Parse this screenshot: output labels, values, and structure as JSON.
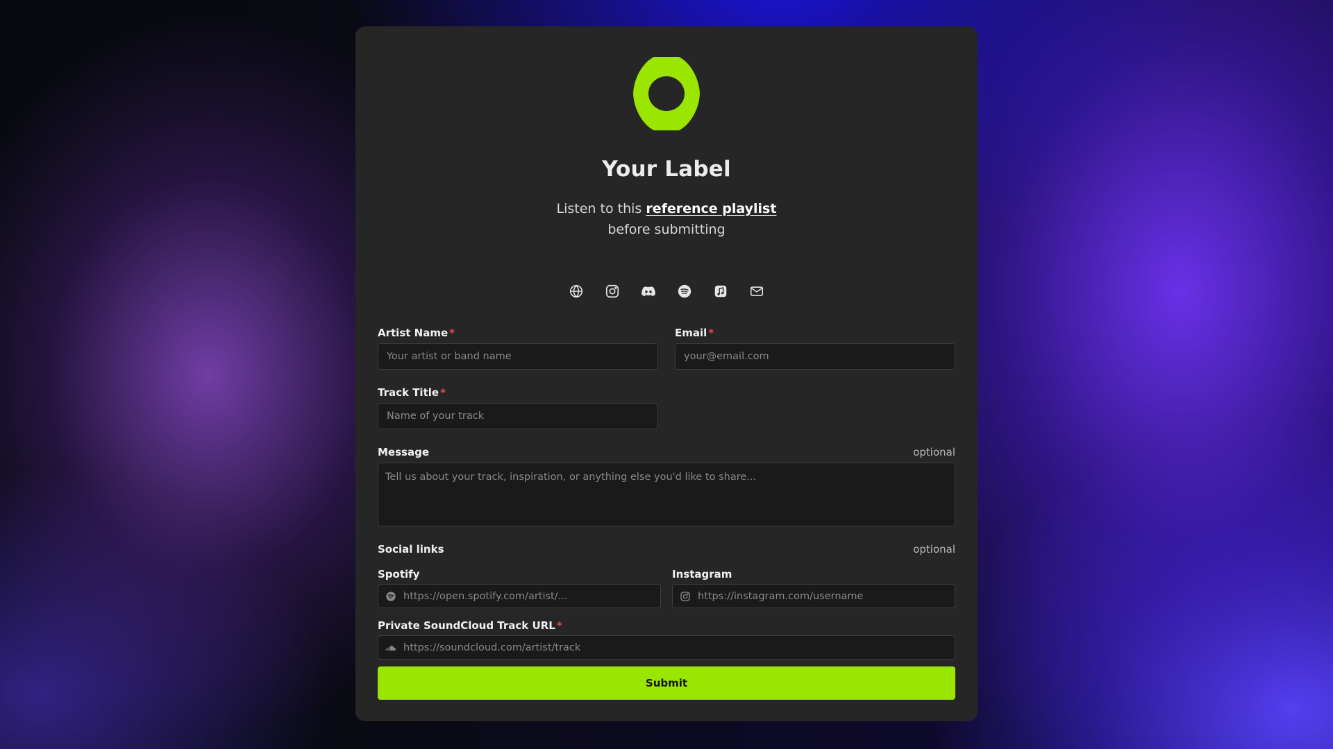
{
  "brand": {
    "name": "Your Label",
    "accent": "#9be600",
    "logo": "ring-logo"
  },
  "intro": {
    "prefix": "Listen to this ",
    "link_text": "reference playlist",
    "suffix": " before submitting"
  },
  "social_icons": [
    "globe-icon",
    "instagram-icon",
    "discord-icon",
    "spotify-icon",
    "music-note-icon",
    "mail-icon"
  ],
  "form": {
    "artist_name": {
      "label": "Artist Name",
      "required_mark": "*",
      "placeholder": "Your artist or band name"
    },
    "email": {
      "label": "Email",
      "required_mark": "*",
      "placeholder": "your@email.com"
    },
    "track_title": {
      "label": "Track Title",
      "required_mark": "*",
      "placeholder": "Name of your track"
    },
    "message": {
      "label": "Message",
      "optional": "optional",
      "placeholder": "Tell us about your track, inspiration, or anything else you'd like to share..."
    },
    "social_links": {
      "label": "Social links",
      "optional": "optional",
      "spotify": {
        "label": "Spotify",
        "placeholder": "https://open.spotify.com/artist/..."
      },
      "instagram": {
        "label": "Instagram",
        "placeholder": "https://instagram.com/username"
      }
    },
    "soundcloud": {
      "label": "Private SoundCloud Track URL",
      "required_mark": "*",
      "placeholder": "https://soundcloud.com/artist/track"
    },
    "submit_label": "Submit"
  }
}
